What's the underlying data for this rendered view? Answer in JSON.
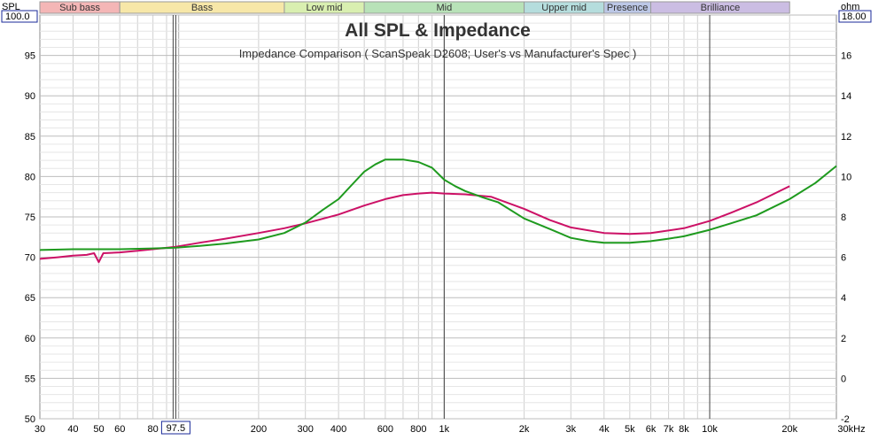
{
  "chart_data": {
    "type": "line",
    "title": "All SPL & Impedance",
    "subtitle": "Impedance Comparison ( ScanSpeak D2608; User's vs Manufacturer's Spec )",
    "y_left_label": "SPL",
    "y_left_top_box": "100.0",
    "y_right_label": "ohm",
    "y_right_top_box": "18.00",
    "x_unit_label": "30kHz",
    "x_scale": "log",
    "xlim": [
      30,
      30000
    ],
    "ylim_left": [
      50,
      100
    ],
    "ylim_right": [
      -2,
      18
    ],
    "grid": true,
    "x_tick_labels": [
      {
        "f": 30,
        "label": "30"
      },
      {
        "f": 40,
        "label": "40"
      },
      {
        "f": 50,
        "label": "50"
      },
      {
        "f": 60,
        "label": "60"
      },
      {
        "f": 80,
        "label": "80"
      },
      {
        "f": 97.5,
        "label": "97.5",
        "boxed": true
      },
      {
        "f": 200,
        "label": "200"
      },
      {
        "f": 300,
        "label": "300"
      },
      {
        "f": 400,
        "label": "400"
      },
      {
        "f": 600,
        "label": "600"
      },
      {
        "f": 800,
        "label": "800"
      },
      {
        "f": 1000,
        "label": "1k"
      },
      {
        "f": 2000,
        "label": "2k"
      },
      {
        "f": 3000,
        "label": "3k"
      },
      {
        "f": 4000,
        "label": "4k"
      },
      {
        "f": 5000,
        "label": "5k"
      },
      {
        "f": 6000,
        "label": "6k"
      },
      {
        "f": 7000,
        "label": "7k"
      },
      {
        "f": 8000,
        "label": "8k"
      },
      {
        "f": 10000,
        "label": "10k"
      },
      {
        "f": 20000,
        "label": "20k"
      }
    ],
    "y_left_ticks": [
      50,
      55,
      60,
      65,
      70,
      75,
      80,
      85,
      90,
      95
    ],
    "y_right_ticks": [
      -2,
      0,
      2,
      4,
      6,
      8,
      10,
      12,
      14,
      16
    ],
    "bands": [
      {
        "label": "Sub bass",
        "from": 20,
        "to": 60,
        "color": "#f4b6b6"
      },
      {
        "label": "Bass",
        "from": 60,
        "to": 250,
        "color": "#f7e7a8"
      },
      {
        "label": "Low mid",
        "from": 250,
        "to": 500,
        "color": "#d9efb0"
      },
      {
        "label": "Mid",
        "from": 500,
        "to": 2000,
        "color": "#b8e2b8"
      },
      {
        "label": "Upper mid",
        "from": 2000,
        "to": 4000,
        "color": "#b5dddd"
      },
      {
        "label": "Presence",
        "from": 4000,
        "to": 6000,
        "color": "#bcc7e6"
      },
      {
        "label": "Brilliance",
        "from": 6000,
        "to": 20000,
        "color": "#cbbde3"
      }
    ],
    "marker_lines": [
      97.5,
      1000,
      10000
    ],
    "series": [
      {
        "color": "#cc1166",
        "x": [
          30,
          35,
          40,
          45,
          48,
          50,
          52,
          60,
          70,
          80,
          97.5,
          120,
          150,
          200,
          250,
          300,
          400,
          500,
          600,
          700,
          800,
          900,
          1000,
          1200,
          1500,
          2000,
          2500,
          3000,
          4000,
          5000,
          6000,
          8000,
          10000,
          12000,
          15000,
          20000
        ],
        "y": [
          69.8,
          70.0,
          70.2,
          70.3,
          70.5,
          69.4,
          70.5,
          70.6,
          70.8,
          71.0,
          71.3,
          71.8,
          72.3,
          73.0,
          73.6,
          74.2,
          75.3,
          76.4,
          77.2,
          77.7,
          77.9,
          78.0,
          77.9,
          77.8,
          77.5,
          76.0,
          74.6,
          73.7,
          73.0,
          72.9,
          73.0,
          73.6,
          74.5,
          75.5,
          76.8,
          78.8
        ]
      },
      {
        "color": "#1e9a1e",
        "x": [
          30,
          40,
          50,
          60,
          80,
          97.5,
          120,
          150,
          200,
          250,
          300,
          350,
          400,
          450,
          500,
          550,
          600,
          700,
          800,
          900,
          1000,
          1100,
          1200,
          1400,
          1600,
          2000,
          2500,
          3000,
          3500,
          4000,
          5000,
          6000,
          7000,
          8000,
          10000,
          12000,
          15000,
          20000,
          25000,
          30000
        ],
        "y": [
          70.9,
          71.0,
          71.0,
          71.0,
          71.1,
          71.2,
          71.4,
          71.7,
          72.2,
          73.0,
          74.3,
          75.9,
          77.2,
          79.0,
          80.6,
          81.5,
          82.1,
          82.1,
          81.8,
          81.1,
          79.6,
          78.8,
          78.2,
          77.4,
          76.8,
          74.8,
          73.5,
          72.4,
          72.0,
          71.8,
          71.8,
          72.0,
          72.3,
          72.6,
          73.4,
          74.2,
          75.2,
          77.2,
          79.2,
          81.3
        ]
      }
    ]
  }
}
